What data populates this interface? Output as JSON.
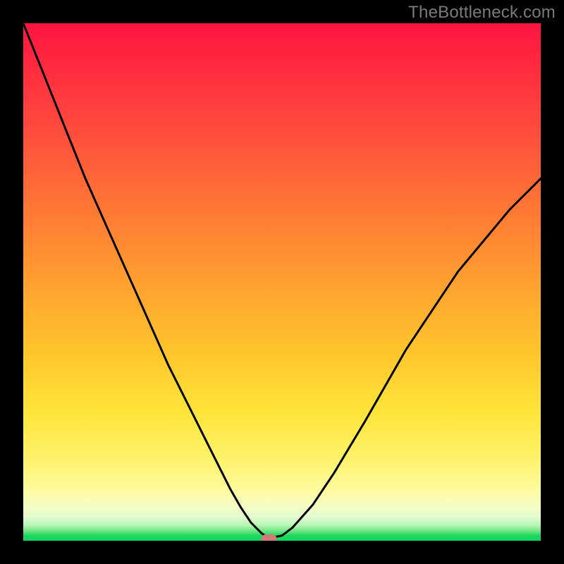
{
  "watermark": "TheBottleneck.com",
  "colors": {
    "frame": "#000000",
    "gradient_top": "#ff1440",
    "gradient_mid": "#ffc62c",
    "gradient_bottom_pale": "#fffb9d",
    "gradient_green": "#0fd65c",
    "curve": "#000000",
    "marker": "#d07a7a"
  },
  "chart_data": {
    "type": "line",
    "title": "",
    "xlabel": "",
    "ylabel": "",
    "xlim": [
      0,
      100
    ],
    "ylim": [
      0,
      100
    ],
    "grid": false,
    "series": [
      {
        "name": "bottleneck-curve",
        "x": [
          0,
          4,
          8,
          12,
          16,
          20,
          24,
          28,
          32,
          36,
          40,
          42,
          44,
          46,
          47,
          48,
          50,
          52,
          56,
          60,
          66,
          74,
          84,
          94,
          100
        ],
        "y": [
          100,
          90,
          80,
          70,
          61,
          52,
          43,
          34,
          26,
          18,
          10,
          6.5,
          3.5,
          1.5,
          0.8,
          0.6,
          1.0,
          2.5,
          7,
          13,
          23,
          37,
          52,
          64,
          70
        ]
      }
    ],
    "markers": [
      {
        "name": "optimal-point",
        "x": 47.5,
        "y": 0.4,
        "shape": "rounded-rect",
        "color": "#d07a7a"
      }
    ]
  }
}
